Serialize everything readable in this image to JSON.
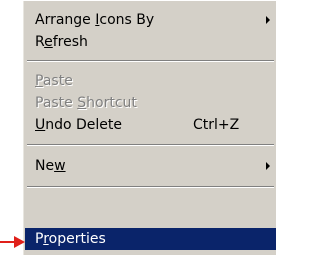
{
  "context_menu": {
    "items": {
      "arrange_icons_by": {
        "label_parts": [
          "Arrange ",
          "I",
          "cons By"
        ],
        "has_submenu": true
      },
      "refresh": {
        "label_parts": [
          "R",
          "e",
          "fresh"
        ]
      },
      "paste": {
        "label_parts": [
          "",
          "P",
          "aste"
        ],
        "disabled": true
      },
      "paste_shortcut": {
        "label_parts": [
          "Paste ",
          "S",
          "hortcut"
        ],
        "disabled": true
      },
      "undo_delete": {
        "label_parts": [
          "",
          "U",
          "ndo Delete"
        ],
        "shortcut": "Ctrl+Z"
      },
      "new": {
        "label_parts": [
          "Ne",
          "w",
          ""
        ],
        "has_submenu": true
      },
      "properties": {
        "label_parts": [
          "P",
          "r",
          "operties"
        ],
        "highlighted": true
      }
    }
  },
  "colors": {
    "menu_background": "#d4d0c8",
    "highlight": "#0a246a",
    "highlight_text": "#ffffff",
    "disabled_text": "#808080",
    "pointer_arrow": "#e0201a"
  },
  "icons": {
    "submenu_arrow": "triangle-right",
    "annotation_pointer": "red-arrow-right"
  }
}
